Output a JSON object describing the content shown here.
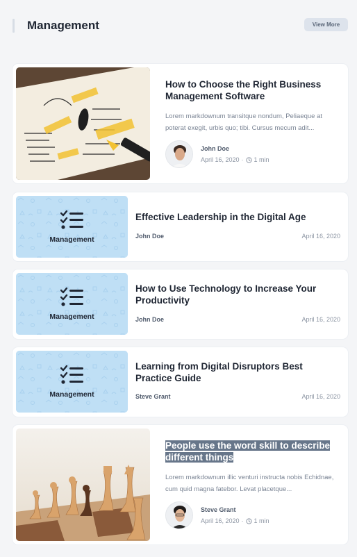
{
  "section": {
    "title": "Management",
    "view_more": "View More"
  },
  "posts": [
    {
      "title": "How to Choose the Right Business Management Software",
      "excerpt": "Lorem markdownum transitque nondum, Peliaeque at poterat exegit, urbis quo; tibi. Cursus mecum adit...",
      "author": "John Doe",
      "date": "April 16, 2020",
      "read_time": "1 min"
    },
    {
      "category": "Management",
      "title": "Effective Leadership in the Digital Age",
      "author": "John Doe",
      "date": "April 16, 2020"
    },
    {
      "category": "Management",
      "title": "How to Use Technology to Increase Your Productivity",
      "author": "John Doe",
      "date": "April 16, 2020"
    },
    {
      "category": "Management",
      "title": "Learning from Digital Disruptors Best Practice Guide",
      "author": "Steve Grant",
      "date": "April 16, 2020"
    },
    {
      "title": "People use the word skill to describe different things",
      "excerpt": "Lorem markdownum illic venturi instructa nobis Echidnae, cum quid magna fatebor. Levat placetque...",
      "author": "Steve Grant",
      "date": "April 16, 2020",
      "read_time": "1 min"
    }
  ],
  "colors": {
    "thumb_bg": "#bfdff5",
    "highlight": "#67768a"
  },
  "icons": {
    "category": "checklist-icon",
    "read_time": "clock-icon"
  }
}
